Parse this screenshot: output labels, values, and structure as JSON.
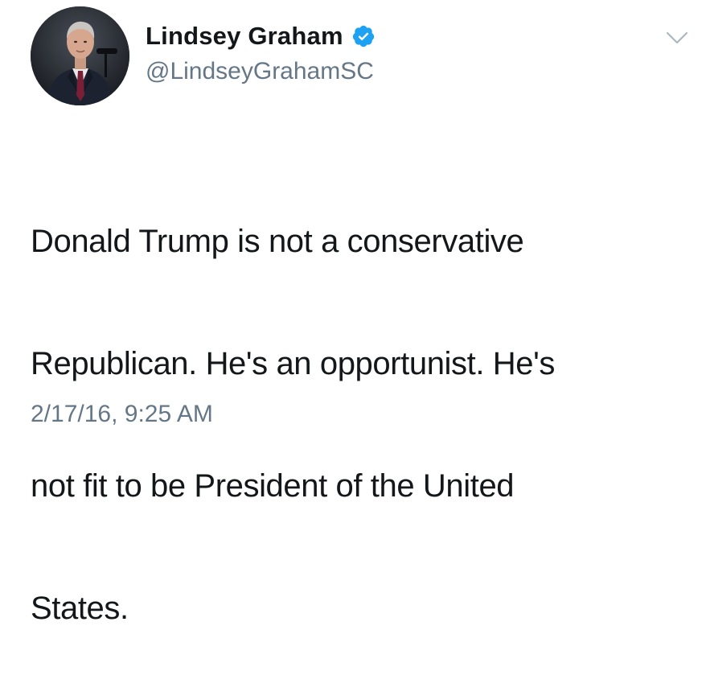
{
  "author": {
    "display_name": "Lindsey Graham",
    "handle": "@LindseyGrahamSC",
    "verified": true,
    "avatar_icon": "profile-photo-man-in-suit"
  },
  "tweet": {
    "lines": [
      "Donald Trump is not a conservative",
      "Republican. He's an opportunist. He's",
      "not fit to be President of the United",
      "States."
    ],
    "timestamp": "2/17/16, 9:25 AM"
  },
  "icons": {
    "verified": "verified-badge-icon",
    "more": "chevron-down-icon"
  },
  "colors": {
    "text": "#14171a",
    "secondary_text": "#657786",
    "verified_blue": "#1da1f2",
    "caret_gray": "#aab8c2",
    "background": "#ffffff"
  }
}
